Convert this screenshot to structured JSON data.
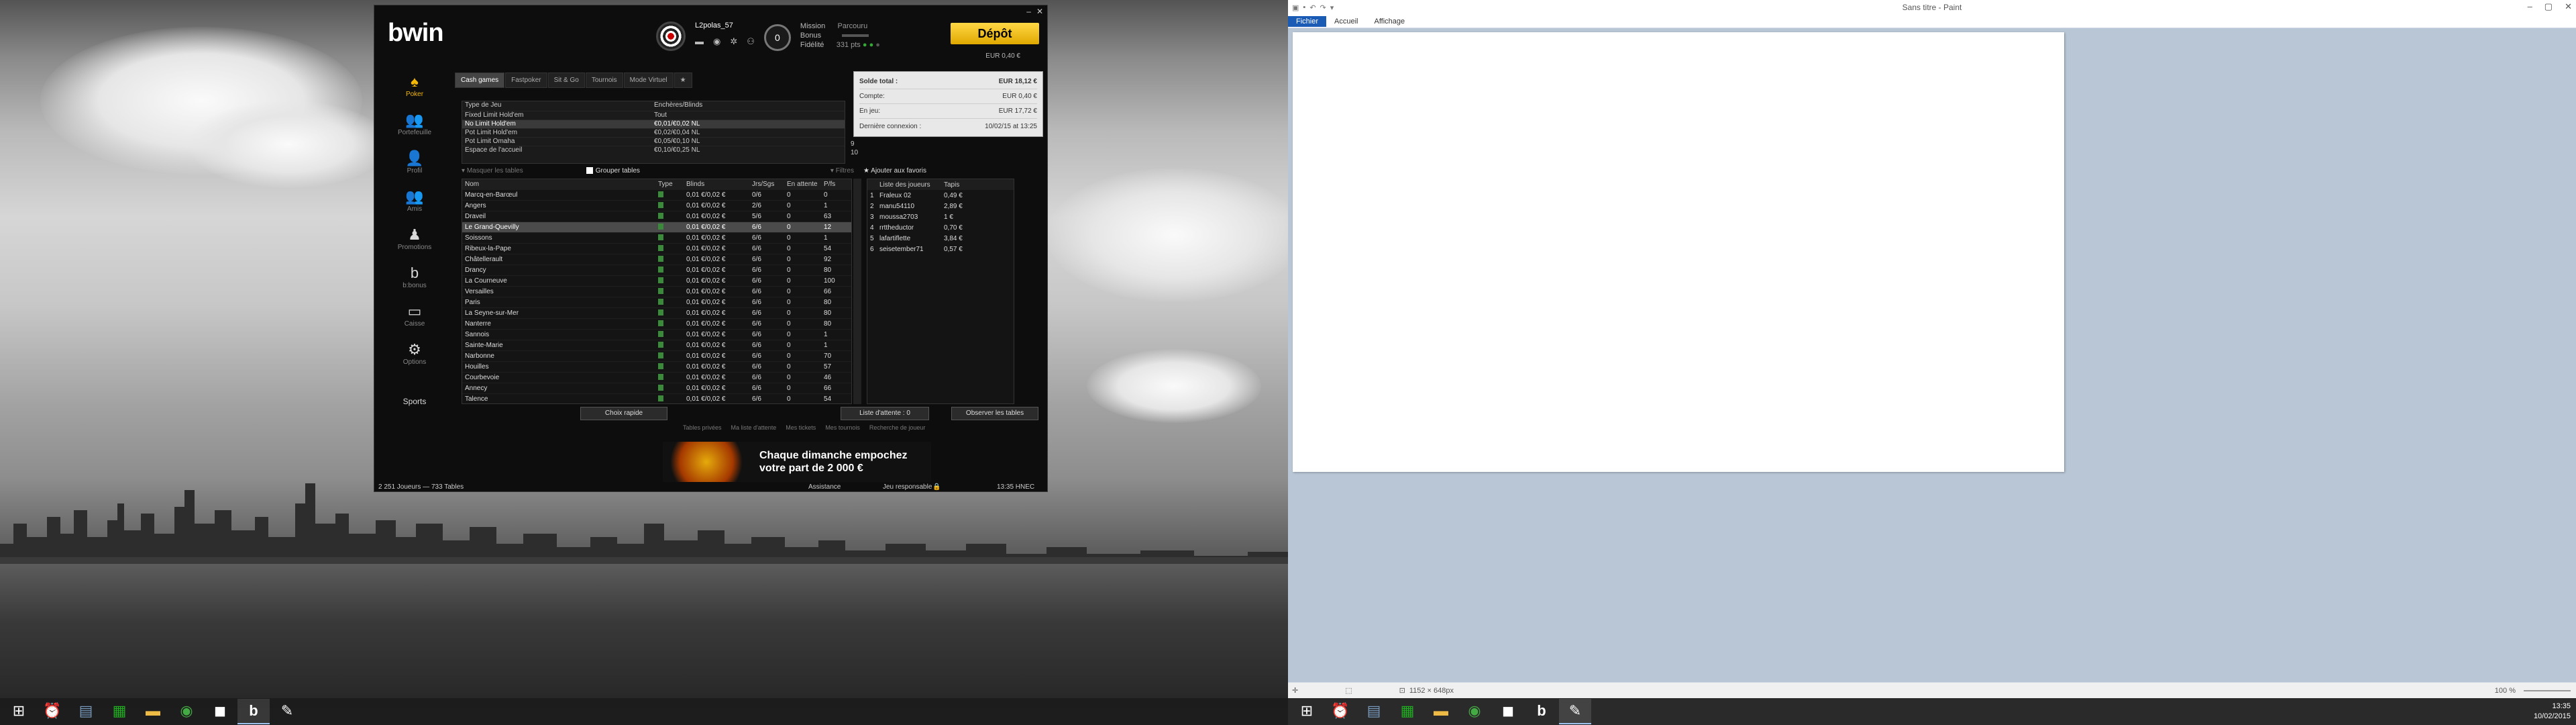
{
  "poker": {
    "logo": "bwin",
    "username": "L2polas_57",
    "badge": "0",
    "mission_label": "Mission",
    "mission_value": "Parcouru",
    "bonus_label": "Bonus",
    "fidelite_label": "Fidélité",
    "fidelite_value": "331 pts",
    "deposit_label": "Dépôt",
    "deposit_sub": "EUR 0,40 €",
    "balance": {
      "total_label": "Solde total :",
      "total_value": "EUR 18,12 €",
      "compte_label": "Compte:",
      "compte_value": "EUR 0,40 €",
      "jeu_label": "En jeu:",
      "jeu_value": "EUR 17,72 €",
      "last_label": "Dernière connexion :",
      "last_value": "10/02/15 at 13:25"
    },
    "nav": [
      {
        "label": "Poker",
        "icon": "♠"
      },
      {
        "label": "Portefeuille",
        "icon": "👥"
      },
      {
        "label": "Profil",
        "icon": "👤"
      },
      {
        "label": "Amis",
        "icon": "👥"
      },
      {
        "label": "Promotions",
        "icon": "♟"
      },
      {
        "label": "b:bonus",
        "icon": "b"
      },
      {
        "label": "Caisse",
        "icon": "▭"
      },
      {
        "label": "Options",
        "icon": "⚙"
      }
    ],
    "sports": "Sports",
    "tabs": [
      "Cash games",
      "Fastpoker",
      "Sit & Go",
      "Tournois",
      "Mode Virtuel",
      "★"
    ],
    "filter": {
      "head_type": "Type de Jeu",
      "head_bets": "Enchères/Blinds",
      "rows": [
        {
          "type": "Fixed Limit Hold'em",
          "bets": "Tout"
        },
        {
          "type": "No Limit Hold'em",
          "bets": "€0,01/€0,02 NL"
        },
        {
          "type": "Pot Limit Hold'em",
          "bets": "€0,02/€0,04 NL"
        },
        {
          "type": "Pot Limit Omaha",
          "bets": "€0,05/€0,10 NL"
        },
        {
          "type": "Espace de l'accueil",
          "bets": "€0,10/€0,25 NL"
        }
      ],
      "counts": [
        "9",
        "10"
      ]
    },
    "opts": {
      "masquer": "Masquer les tables",
      "grouper": "Grouper tables",
      "filtres": "Filtres",
      "favoris": "Ajouter aux favoris"
    },
    "table_head": {
      "nom": "Nom",
      "type": "Type",
      "blinds": "Blinds",
      "jrs": "Jrs/Sgs",
      "attente": "En attente",
      "pf": "P/fs"
    },
    "tables": [
      {
        "nom": "Marcq-en-Barœul",
        "blinds": "0,01 €/0,02 €",
        "jrs": "0/6",
        "att": "0",
        "pf": "0"
      },
      {
        "nom": "Angers",
        "blinds": "0,01 €/0,02 €",
        "jrs": "2/6",
        "att": "0",
        "pf": "1"
      },
      {
        "nom": "Draveil",
        "blinds": "0,01 €/0,02 €",
        "jrs": "5/6",
        "att": "0",
        "pf": "63"
      },
      {
        "nom": "Le Grand-Quevilly",
        "blinds": "0,01 €/0,02 €",
        "jrs": "6/6",
        "att": "0",
        "pf": "12"
      },
      {
        "nom": "Soissons",
        "blinds": "0,01 €/0,02 €",
        "jrs": "6/6",
        "att": "0",
        "pf": "1"
      },
      {
        "nom": "Ribeux-la-Pape",
        "blinds": "0,01 €/0,02 €",
        "jrs": "6/6",
        "att": "0",
        "pf": "54"
      },
      {
        "nom": "Châtellerault",
        "blinds": "0,01 €/0,02 €",
        "jrs": "6/6",
        "att": "0",
        "pf": "92"
      },
      {
        "nom": "Drancy",
        "blinds": "0,01 €/0,02 €",
        "jrs": "6/6",
        "att": "0",
        "pf": "80"
      },
      {
        "nom": "La Courneuve",
        "blinds": "0,01 €/0,02 €",
        "jrs": "6/6",
        "att": "0",
        "pf": "100"
      },
      {
        "nom": "Versailles",
        "blinds": "0,01 €/0,02 €",
        "jrs": "6/6",
        "att": "0",
        "pf": "66"
      },
      {
        "nom": "Paris",
        "blinds": "0,01 €/0,02 €",
        "jrs": "6/6",
        "att": "0",
        "pf": "80"
      },
      {
        "nom": "La Seyne-sur-Mer",
        "blinds": "0,01 €/0,02 €",
        "jrs": "6/6",
        "att": "0",
        "pf": "80"
      },
      {
        "nom": "Nanterre",
        "blinds": "0,01 €/0,02 €",
        "jrs": "6/6",
        "att": "0",
        "pf": "80"
      },
      {
        "nom": "Sannois",
        "blinds": "0,01 €/0,02 €",
        "jrs": "6/6",
        "att": "0",
        "pf": "1"
      },
      {
        "nom": "Sainte-Marie",
        "blinds": "0,01 €/0,02 €",
        "jrs": "6/6",
        "att": "0",
        "pf": "1"
      },
      {
        "nom": "Narbonne",
        "blinds": "0,01 €/0,02 €",
        "jrs": "6/6",
        "att": "0",
        "pf": "70"
      },
      {
        "nom": "Houilles",
        "blinds": "0,01 €/0,02 €",
        "jrs": "6/6",
        "att": "0",
        "pf": "57"
      },
      {
        "nom": "Courbevoie",
        "blinds": "0,01 €/0,02 €",
        "jrs": "6/6",
        "att": "0",
        "pf": "46"
      },
      {
        "nom": "Annecy",
        "blinds": "0,01 €/0,02 €",
        "jrs": "6/6",
        "att": "0",
        "pf": "66"
      },
      {
        "nom": "Talence",
        "blinds": "0,01 €/0,02 €",
        "jrs": "6/6",
        "att": "0",
        "pf": "54"
      }
    ],
    "players_head": {
      "name": "Liste des joueurs",
      "tapis": "Tapis"
    },
    "players": [
      {
        "n": "1",
        "name": "Fraleux 02",
        "tapis": "0,49 €"
      },
      {
        "n": "2",
        "name": "manu54110",
        "tapis": "2,89 €"
      },
      {
        "n": "3",
        "name": "moussa2703",
        "tapis": "1 €"
      },
      {
        "n": "4",
        "name": "rrttheductor",
        "tapis": "0,70 €"
      },
      {
        "n": "5",
        "name": "lafartiflette",
        "tapis": "3,84 €"
      },
      {
        "n": "6",
        "name": "seisetember71",
        "tapis": "0,57 €"
      }
    ],
    "buttons": {
      "choix": "Choix rapide",
      "liste": "Liste d'attente : 0",
      "observer": "Observer les tables"
    },
    "links": [
      "Tables privées",
      "Ma liste d'attente",
      "Mes tickets",
      "Mes tournois",
      "Recherche de joueur"
    ],
    "ad": {
      "line1": "Chaque dimanche empochez",
      "line2": "votre part de 2 000 €"
    },
    "footer": {
      "players": "2 251 Joueurs",
      "tables": "733 Tables",
      "assistance": "Assistance",
      "responsable": "Jeu responsable",
      "clock": "13:35 HNEC"
    }
  },
  "paint": {
    "title": "Sans titre - Paint",
    "menu": [
      "Fichier",
      "Accueil",
      "Affichage"
    ],
    "size": "1152 × 648px",
    "zoom": "100 %"
  },
  "taskbar": {
    "time": "13:35",
    "date": "10/02/2015"
  }
}
